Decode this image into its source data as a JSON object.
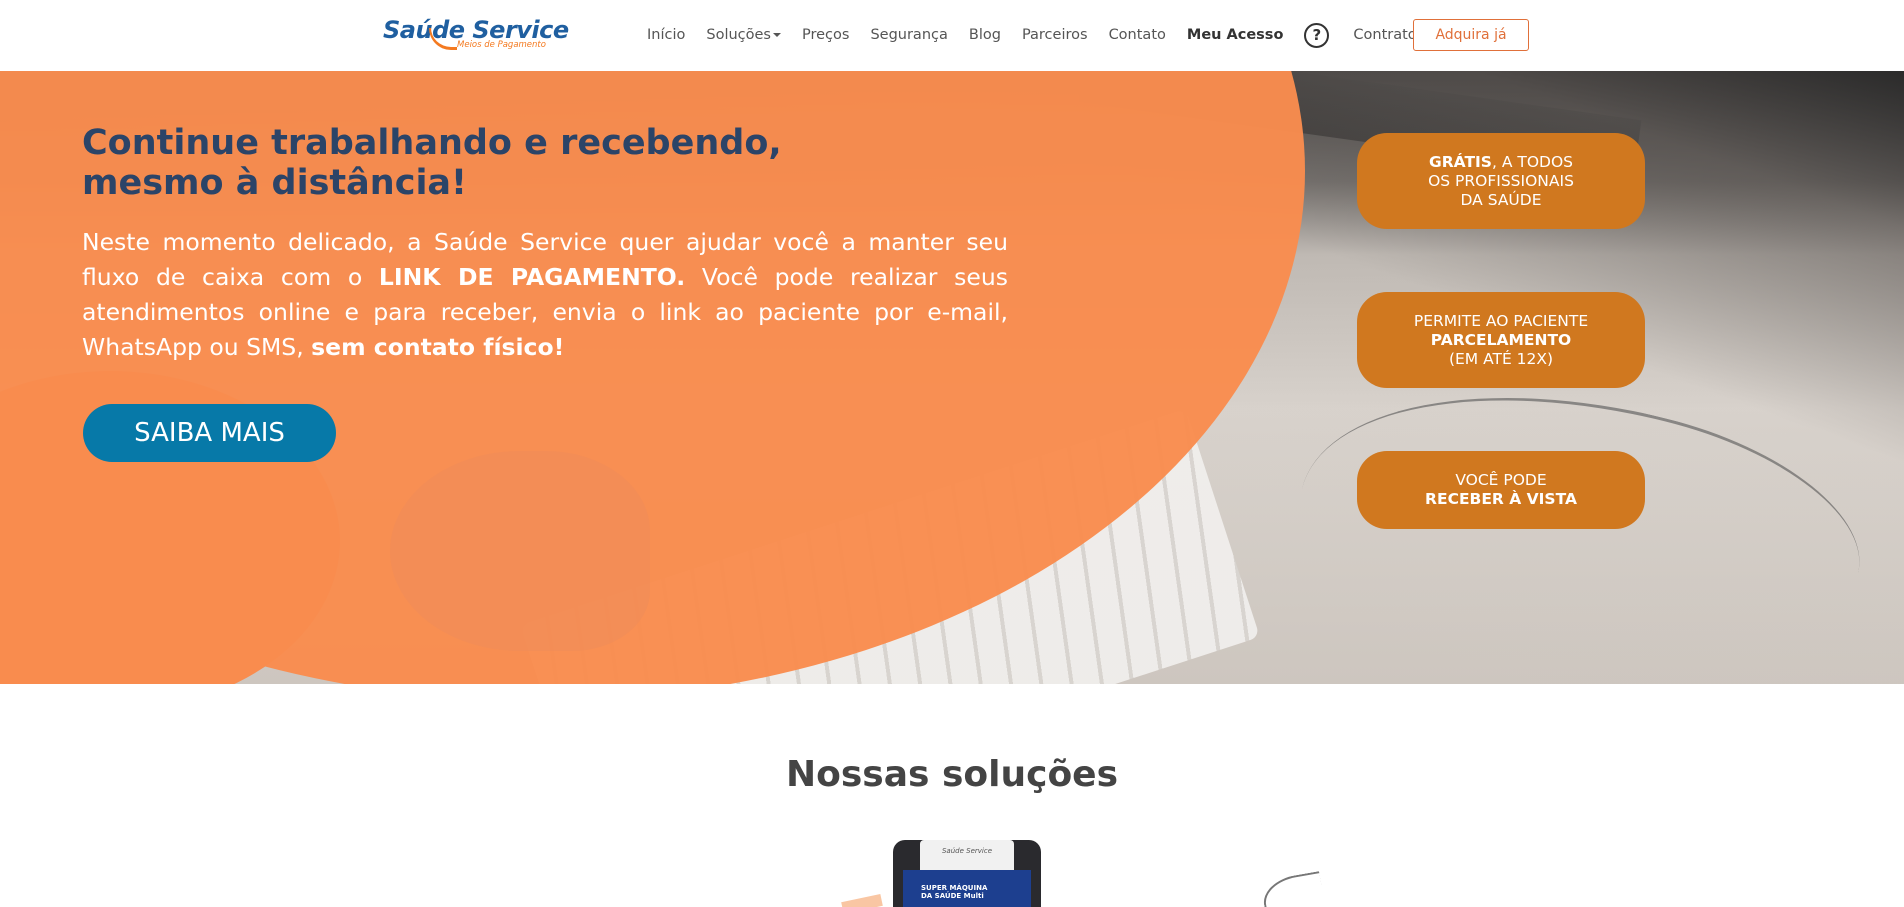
{
  "header": {
    "logo": {
      "main": "Saúde Service",
      "sub": "Meios de Pagamento"
    },
    "nav": [
      {
        "label": "Início"
      },
      {
        "label": "Soluções"
      },
      {
        "label": "Preços"
      },
      {
        "label": "Segurança"
      },
      {
        "label": "Blog"
      },
      {
        "label": "Parceiros"
      },
      {
        "label": "Contato"
      },
      {
        "label": "Meu Acesso"
      }
    ],
    "help_icon": "?",
    "contract_label": "Contrato",
    "cta_label": "Adquira já"
  },
  "hero": {
    "title_line1": "Continue trabalhando e recebendo,",
    "title_line2": "mesmo à distância!",
    "text_part1": "Neste momento delicado, a Saúde Service quer ajudar você a manter seu fluxo de caixa com o ",
    "text_bold1": "LINK DE PAGAMENTO.",
    "text_part2": " Você pode realizar seus atendimentos online e para receber, envia o link ao paciente por e-mail, WhatsApp ou SMS, ",
    "text_bold2": "sem contato físico!",
    "button_label": "SAIBA MAIS",
    "pills": [
      {
        "bold": "Grátis",
        "rest_line1": ", a todos",
        "line2": "os profissionais",
        "line3": "da saúde"
      },
      {
        "line1": "Permite ao paciente",
        "bold": "Parcelamento",
        "line3": "(em até 12x)"
      },
      {
        "line1": "Você pode",
        "bold": "Receber à vista"
      }
    ]
  },
  "solutions": {
    "title_light": "Nossas ",
    "title_bold": "soluções",
    "machine_paper": "Saúde Service",
    "machine_screen_line1": "SUPER MÁQUINA",
    "machine_screen_line2": "DA SAÚDE",
    "machine_screen_brand": "Multi"
  },
  "colors": {
    "orange": "#f98c4e",
    "pill_orange": "#d0781f",
    "navy_title": "#2b4468",
    "button_blue": "#0779a8",
    "cta_border": "#e0703a"
  }
}
